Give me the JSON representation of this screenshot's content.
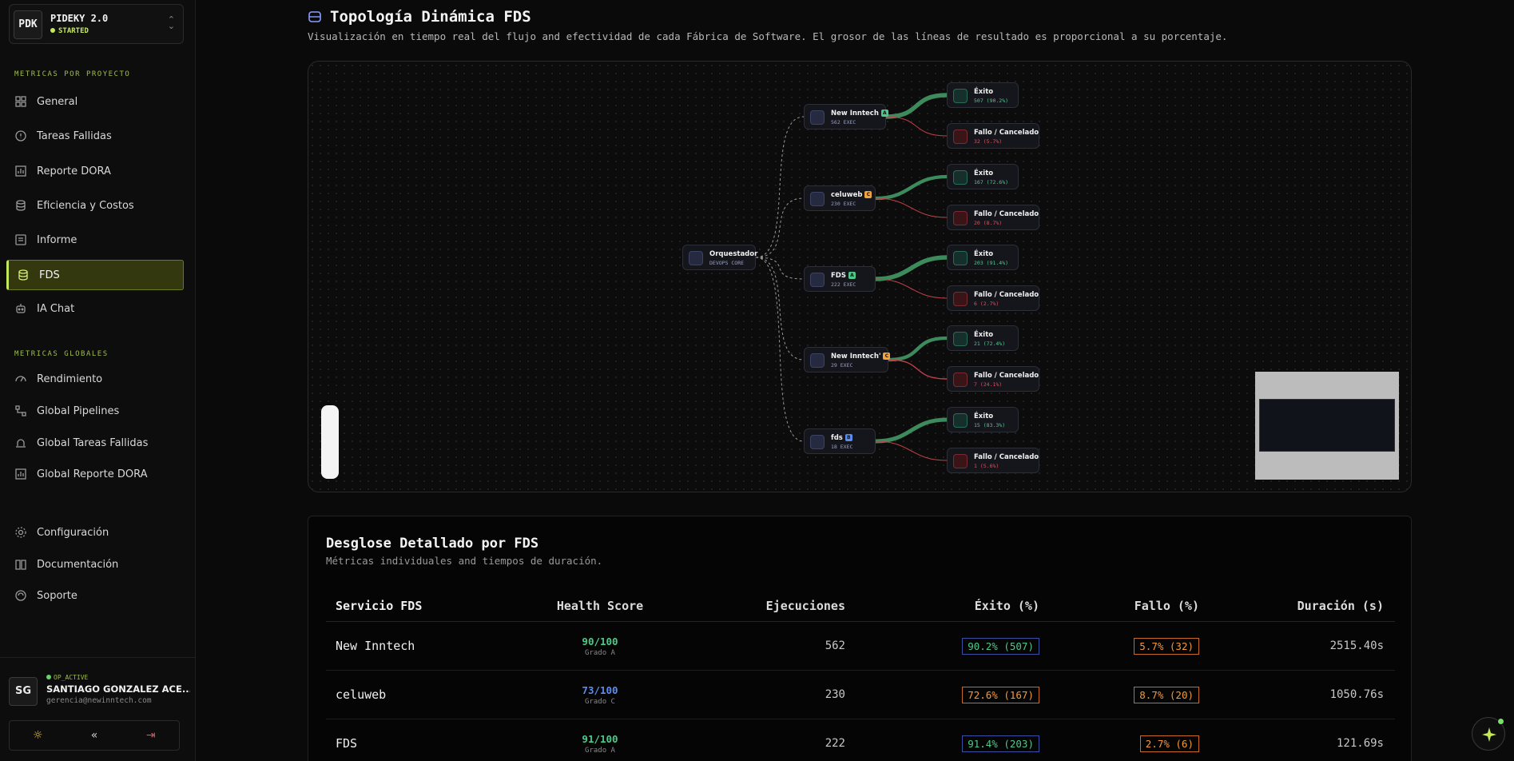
{
  "brand": {
    "logo": "PDK",
    "title": "PIDEKY 2.0",
    "status": "STARTED"
  },
  "sidebar": {
    "section_project": "METRICAS POR PROYECTO",
    "section_global": "METRICAS GLOBALES",
    "items": [
      {
        "label": "General",
        "icon": "grid-icon"
      },
      {
        "label": "Tareas Fallidas",
        "icon": "alert-circle-icon"
      },
      {
        "label": "Reporte DORA",
        "icon": "bar-chart-icon"
      },
      {
        "label": "Eficiencia y Costos",
        "icon": "database-icon"
      },
      {
        "label": "Informe",
        "icon": "report-icon"
      },
      {
        "label": "FDS",
        "icon": "layers-icon",
        "active": true
      },
      {
        "label": "IA Chat",
        "icon": "bot-icon"
      }
    ],
    "global_items": [
      {
        "label": "Rendimiento",
        "icon": "gauge-icon"
      },
      {
        "label": "Global Pipelines",
        "icon": "pipeline-icon"
      },
      {
        "label": "Global Tareas Fallidas",
        "icon": "siren-icon"
      },
      {
        "label": "Global Reporte DORA",
        "icon": "bar-chart-icon"
      }
    ],
    "bottom_items": [
      {
        "label": "Configuración",
        "icon": "gear-icon"
      },
      {
        "label": "Documentación",
        "icon": "book-icon"
      },
      {
        "label": "Soporte",
        "icon": "support-icon"
      }
    ]
  },
  "user": {
    "initials": "SG",
    "status": "OP_ACTIVE",
    "name": "SANTIAGO GONZALEZ ACE...",
    "email": "gerencia@newinntech.com"
  },
  "topology": {
    "title": "Topología Dinámica FDS",
    "description": "Visualización en tiempo real del flujo and efectividad de cada Fábrica de Software. El grosor de las líneas de resultado es proporcional a su porcentaje.",
    "root": {
      "name": "Orquestador",
      "sub": "DEVOPS CORE"
    },
    "factories": [
      {
        "name": "New Inntech",
        "grade": "A",
        "grade_color": "#4ec98a",
        "sub": "562 EXEC",
        "ok": {
          "label": "Éxito",
          "sub": "507 (90.2%)",
          "pct": 90.2
        },
        "ko": {
          "label": "Fallo / Cancelado",
          "sub": "32 (5.7%)",
          "pct": 5.7
        }
      },
      {
        "name": "celuweb",
        "grade": "C",
        "grade_color": "#f2a33d",
        "sub": "230 EXEC",
        "ok": {
          "label": "Éxito",
          "sub": "167 (72.6%)",
          "pct": 72.6
        },
        "ko": {
          "label": "Fallo / Cancelado",
          "sub": "20 (8.7%)",
          "pct": 8.7
        }
      },
      {
        "name": "FDS",
        "grade": "A",
        "grade_color": "#4ec98a",
        "sub": "222 EXEC",
        "ok": {
          "label": "Éxito",
          "sub": "203 (91.4%)",
          "pct": 91.4
        },
        "ko": {
          "label": "Fallo / Cancelado",
          "sub": "6 (2.7%)",
          "pct": 2.7
        }
      },
      {
        "name": "New Inntech'",
        "grade": "C",
        "grade_color": "#f2a33d",
        "sub": "29 EXEC",
        "ok": {
          "label": "Éxito",
          "sub": "21 (72.4%)",
          "pct": 72.4
        },
        "ko": {
          "label": "Fallo / Cancelado",
          "sub": "7 (24.1%)",
          "pct": 24.1
        }
      },
      {
        "name": "fds",
        "grade": "B",
        "grade_color": "#5b8cf0",
        "sub": "18 EXEC",
        "ok": {
          "label": "Éxito",
          "sub": "15 (83.3%)",
          "pct": 83.3
        },
        "ko": {
          "label": "Fallo / Cancelado",
          "sub": "1 (5.6%)",
          "pct": 5.6
        }
      }
    ]
  },
  "table": {
    "title": "Desglose Detallado por FDS",
    "subtitle": "Métricas individuales and tiempos de duración.",
    "headers": {
      "service": "Servicio FDS",
      "health": "Health Score",
      "executions": "Ejecuciones",
      "success": "Éxito (%)",
      "failure": "Fallo (%)",
      "duration": "Duración (s)"
    },
    "rows": [
      {
        "service": "New Inntech",
        "score": "90/100",
        "grade": "Grado A",
        "score_color": "#4ec98a",
        "executions": "562",
        "success": "90.2% (507)",
        "success_style": "green",
        "failure": "5.7% (32)",
        "duration": "2515.40s"
      },
      {
        "service": "celuweb",
        "score": "73/100",
        "grade": "Grado C",
        "score_color": "#5b8cf0",
        "executions": "230",
        "success": "72.6% (167)",
        "success_style": "orange",
        "failure": "8.7% (20)",
        "duration": "1050.76s"
      },
      {
        "service": "FDS",
        "score": "91/100",
        "grade": "Grado A",
        "score_color": "#4ec98a",
        "executions": "222",
        "success": "91.4% (203)",
        "success_style": "green",
        "failure": "2.7% (6)",
        "duration": "121.69s"
      }
    ]
  },
  "colors": {
    "accent": "#c5e85b",
    "success": "#4ec98a",
    "failure": "#e0505a",
    "warning": "#f29a3d"
  }
}
